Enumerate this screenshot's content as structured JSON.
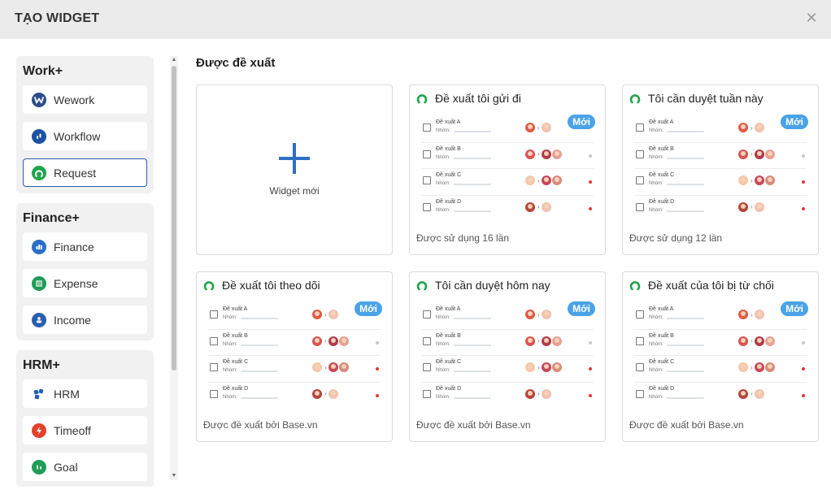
{
  "header": {
    "title": "TẠO WIDGET",
    "close_glyph": "✕"
  },
  "sidebar": {
    "groups": [
      {
        "title": "Work+",
        "items": [
          {
            "label": "Wework",
            "icon": "wework-icon",
            "color": "#2b4d8c"
          },
          {
            "label": "Workflow",
            "icon": "workflow-icon",
            "color": "#1d52a3"
          },
          {
            "label": "Request",
            "icon": "request-icon",
            "color": "#1fa54b",
            "active": true
          }
        ]
      },
      {
        "title": "Finance+",
        "items": [
          {
            "label": "Finance",
            "icon": "finance-icon",
            "color": "#2a6fc9"
          },
          {
            "label": "Expense",
            "icon": "expense-icon",
            "color": "#1f9d57"
          },
          {
            "label": "Income",
            "icon": "income-icon",
            "color": "#2a5fae"
          }
        ]
      },
      {
        "title": "HRM+",
        "items": [
          {
            "label": "HRM",
            "icon": "hrm-icon",
            "color": "#1f5db3"
          },
          {
            "label": "Timeoff",
            "icon": "timeoff-icon",
            "color": "#e2422b"
          },
          {
            "label": "Goal",
            "icon": "goal-icon",
            "color": "#1f9d57"
          }
        ]
      }
    ]
  },
  "main": {
    "section_title": "Được đề xuất",
    "new_widget_label": "Widget mới",
    "badge_label": "Mới",
    "row_template": {
      "names": [
        "Đề xuất A",
        "Đề xuất B",
        "Đề xuất C",
        "Đề xuất D"
      ],
      "sub_label": "Nhóm:"
    },
    "cards": [
      {
        "title": "Đề xuất tôi gửi đi",
        "footer": "Được sử dụng 16 lần"
      },
      {
        "title": "Tôi cần duyệt tuần này",
        "footer": "Được sử dụng 12 lần"
      },
      {
        "title": "Đề xuất tôi theo dõi",
        "footer": "Được đề xuất bởi Base.vn"
      },
      {
        "title": "Tôi cần duyệt hôm nay",
        "footer": "Được đề xuất bởi Base.vn"
      },
      {
        "title": "Đề xuất của tôi bị từ chối",
        "footer": "Được đề xuất bởi Base.vn"
      }
    ]
  },
  "colors": {
    "accent": "#2f6fc4",
    "badge": "#4aa3e8",
    "status_red": "#e53935",
    "status_grey": "#c8c8c8",
    "request_green": "#1fa54b"
  }
}
